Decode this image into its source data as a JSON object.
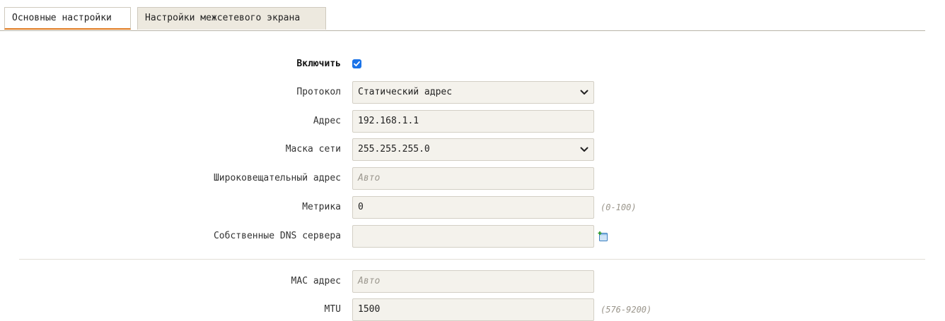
{
  "tabs": [
    {
      "label": "Основные настройки",
      "active": true
    },
    {
      "label": "Настройки межсетевого экрана",
      "active": false
    }
  ],
  "form": {
    "enable": {
      "label": "Включить",
      "checked": true
    },
    "protocol": {
      "label": "Протокол",
      "value": "Статический адрес"
    },
    "address": {
      "label": "Адрес",
      "value": "192.168.1.1"
    },
    "netmask": {
      "label": "Маска сети",
      "value": "255.255.255.0"
    },
    "broadcast": {
      "label": "Широковещательный адрес",
      "placeholder": "Авто"
    },
    "metric": {
      "label": "Метрика",
      "value": "0",
      "hint": "(0-100)"
    },
    "dns": {
      "label": "Собственные DNS сервера",
      "value": ""
    },
    "mac": {
      "label": "MAC адрес",
      "placeholder": "Авто"
    },
    "mtu": {
      "label": "MTU",
      "value": "1500",
      "hint": "(576-9200)"
    }
  },
  "colors": {
    "accent": "#e07a1f",
    "checkbox": "#1a73e8",
    "field_bg": "#f4f2ec"
  },
  "icons": {
    "add_dns": "add-document-icon",
    "select": "chevron-down-icon"
  }
}
